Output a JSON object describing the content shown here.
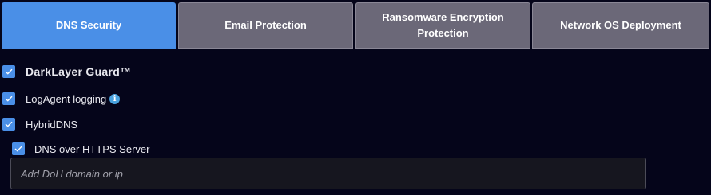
{
  "tabs": [
    {
      "label": "DNS Security",
      "active": true
    },
    {
      "label": "Email Protection",
      "active": false
    },
    {
      "label": "Ransomware Encryption Protection",
      "active": false
    },
    {
      "label": "Network OS Deployment",
      "active": false
    }
  ],
  "options": {
    "darklayer_guard": {
      "label": "DarkLayer Guard™",
      "checked": true
    },
    "logagent_logging": {
      "label": "LogAgent logging",
      "checked": true,
      "info_icon": "i"
    },
    "hybrid_dns": {
      "label": "HybridDNS",
      "checked": true
    },
    "doh_server": {
      "label": "DNS over HTTPS Server",
      "checked": true
    }
  },
  "doh_input": {
    "value": "",
    "placeholder": "Add DoH domain or ip"
  },
  "colors": {
    "background": "#05051a",
    "accent": "#4a8fe7",
    "tab_inactive": "#6b6878",
    "info": "#4aa3df"
  },
  "icons": {
    "checkbox": "checkmark-icon",
    "info": "info-icon"
  }
}
